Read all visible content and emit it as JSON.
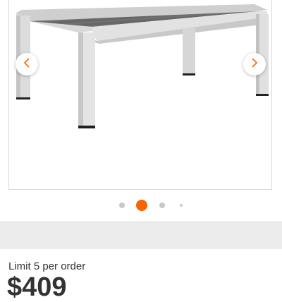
{
  "carousel": {
    "product_image": "outdoor-coffee-table-photo",
    "prev_icon": "chevron-left-icon",
    "next_icon": "chevron-right-icon",
    "dot_count": 4,
    "active_index": 1,
    "accent_color": "#f96302"
  },
  "order": {
    "limit_text": "Limit 5 per order"
  },
  "price": {
    "partial_text": "$409"
  }
}
